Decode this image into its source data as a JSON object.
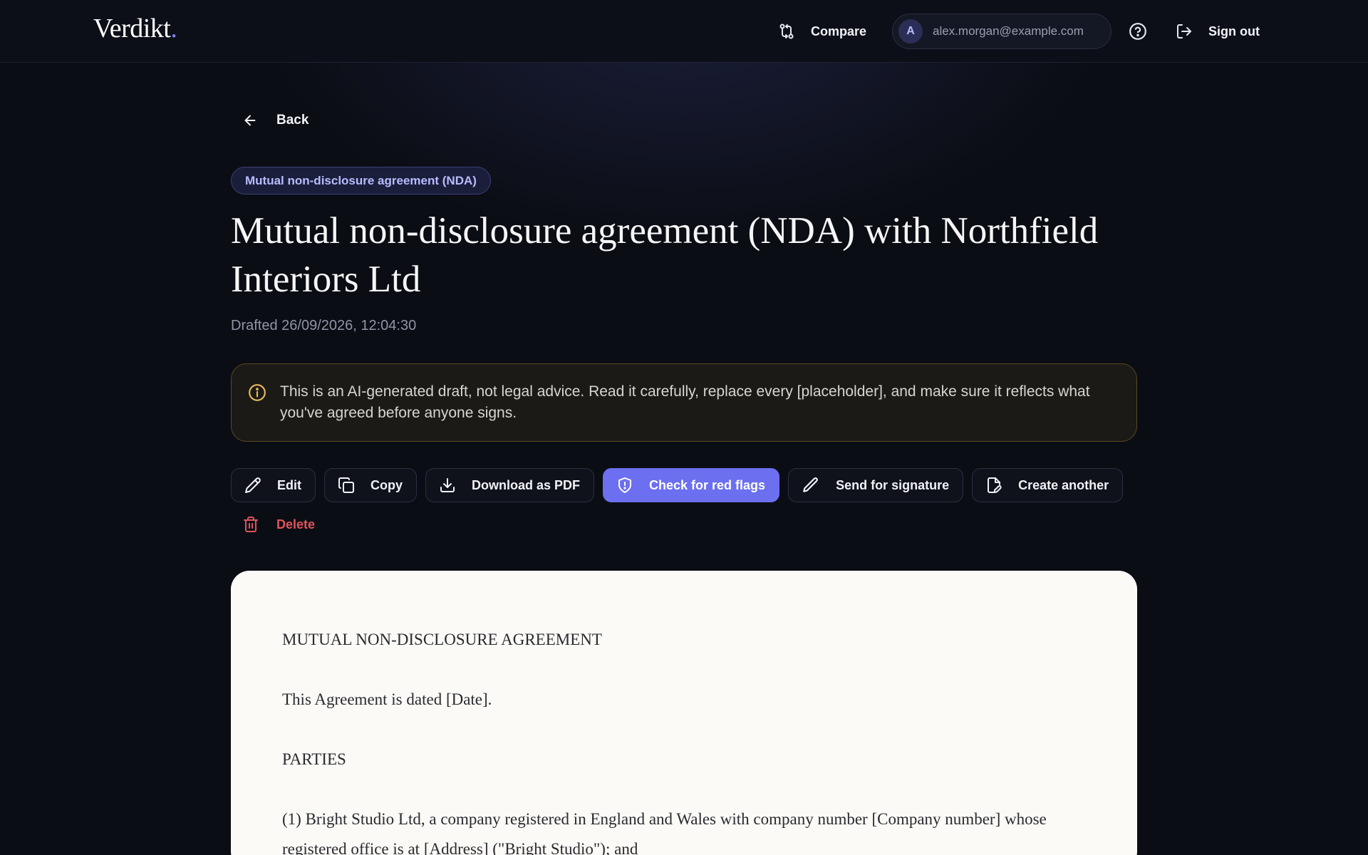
{
  "app": {
    "brand": "Verdikt",
    "brand_dot": ".",
    "accent": "#6b6ff0"
  },
  "header": {
    "compare_label": "Compare",
    "user_initial": "A",
    "user_email": "alex.morgan@example.com",
    "signout_label": "Sign out"
  },
  "page": {
    "back_label": "Back",
    "tag": "Mutual non-disclosure agreement (NDA)",
    "title": "Mutual non-disclosure agreement (NDA) with Northfield Interiors Ltd",
    "drafted": "Drafted 26/09/2026, 12:04:30",
    "notice": "This is an AI-generated draft, not legal advice. Read it carefully, replace every [placeholder], and make sure it reflects what you've agreed before anyone signs."
  },
  "actions": {
    "edit": "Edit",
    "copy": "Copy",
    "download": "Download as PDF",
    "red_flags": "Check for red flags",
    "send": "Send for signature",
    "create": "Create another",
    "delete": "Delete"
  },
  "document": {
    "heading": "MUTUAL NON-DISCLOSURE AGREEMENT",
    "dated": "This Agreement is dated [Date].",
    "parties_heading": "PARTIES",
    "party_1": "(1) Bright Studio Ltd, a company registered in England and Wales with company number [Company number] whose registered office is at [Address] (\"Bright Studio\"); and"
  }
}
